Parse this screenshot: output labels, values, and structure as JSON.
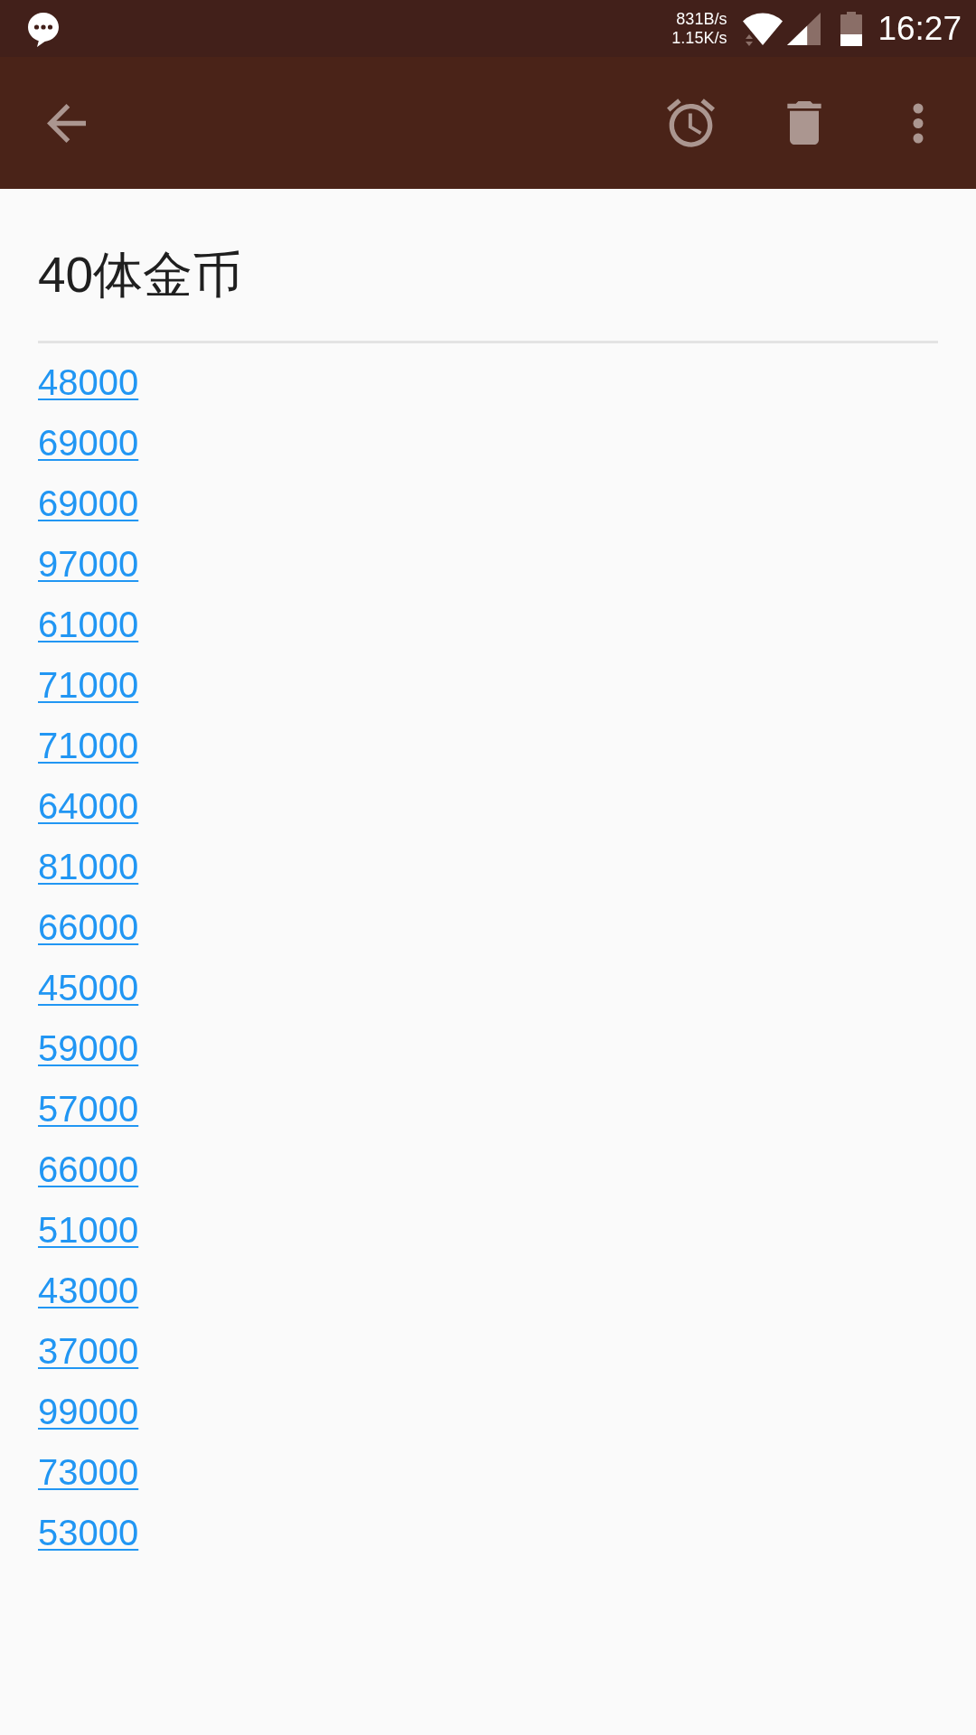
{
  "status_bar": {
    "net_speed": [
      "831B/s",
      "1.15K/s"
    ],
    "time": "16:27"
  },
  "note": {
    "title": "40体金币",
    "lines": [
      "48000",
      "69000",
      "69000",
      "97000",
      "61000",
      "71000",
      "71000",
      "64000",
      "81000",
      "66000",
      "45000",
      "59000",
      "57000",
      "66000",
      "51000",
      "43000",
      "37000",
      "99000",
      "73000",
      "53000"
    ]
  }
}
